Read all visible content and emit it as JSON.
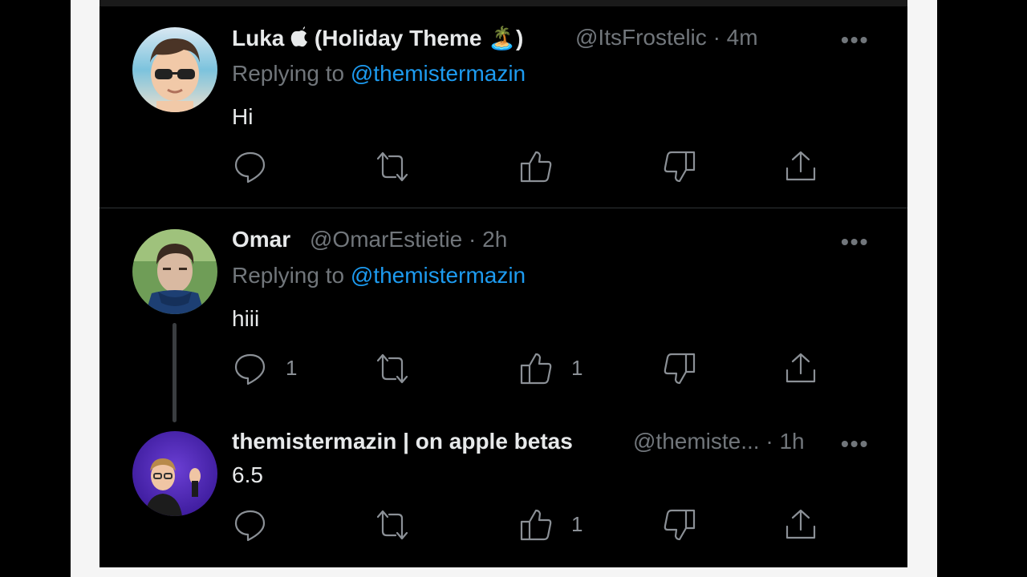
{
  "tweets": [
    {
      "name": "Luka",
      "name_suffix": "(Holiday Theme 🏝️)",
      "handle": "@ItsFrostelic",
      "time": "· 4m",
      "replying_label": "Replying to",
      "replying_to": "@themistermazin",
      "text": "Hi",
      "counts": {
        "reply": "",
        "retweet": "",
        "like": ""
      }
    },
    {
      "name": "Omar",
      "handle": "@OmarEstietie",
      "time": "· 2h",
      "replying_label": "Replying to",
      "replying_to": "@themistermazin",
      "text": "hiii",
      "counts": {
        "reply": "1",
        "retweet": "",
        "like": "1"
      }
    },
    {
      "name": "themistermazin | on apple betas",
      "handle": "@themiste...",
      "time": "· 1h",
      "text": "6.5",
      "counts": {
        "reply": "",
        "retweet": "",
        "like": "1"
      }
    }
  ],
  "more_label": "•••",
  "colors": {
    "mention": "#1d9bf0",
    "muted": "#71767b",
    "text": "#e7e9ea",
    "background": "#000000"
  }
}
